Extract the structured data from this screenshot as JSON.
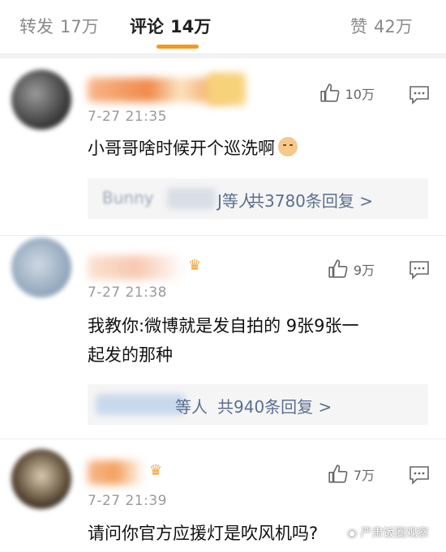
{
  "tabs": {
    "repost": {
      "label": "转发",
      "count": "17万"
    },
    "comments": {
      "label": "评论",
      "count": "14万"
    },
    "likes": {
      "label": "赞",
      "count": "42万"
    }
  },
  "comments": [
    {
      "time": "7-27 21:35",
      "likes": "10万",
      "text": "小哥哥啥时候开个巡洗啊",
      "replies_tail": "J等人",
      "replies_count": "共3780条回复 >",
      "reply_name_hint": "Bunny"
    },
    {
      "time": "7-27 21:38",
      "likes": "9万",
      "text_line1": "我教你:微博就是发自拍的 9张9张一",
      "text_line2": "起发的那种",
      "replies_tail": "等人",
      "replies_count": "共940条回复 >"
    },
    {
      "time": "7-27 21:39",
      "likes": "7万",
      "text": "请问你官方应援灯是吹风机吗?"
    }
  ],
  "watermark": "严肃饭圈观察",
  "colors": {
    "accent": "#f39a1d",
    "link": "#5a6f8f"
  }
}
